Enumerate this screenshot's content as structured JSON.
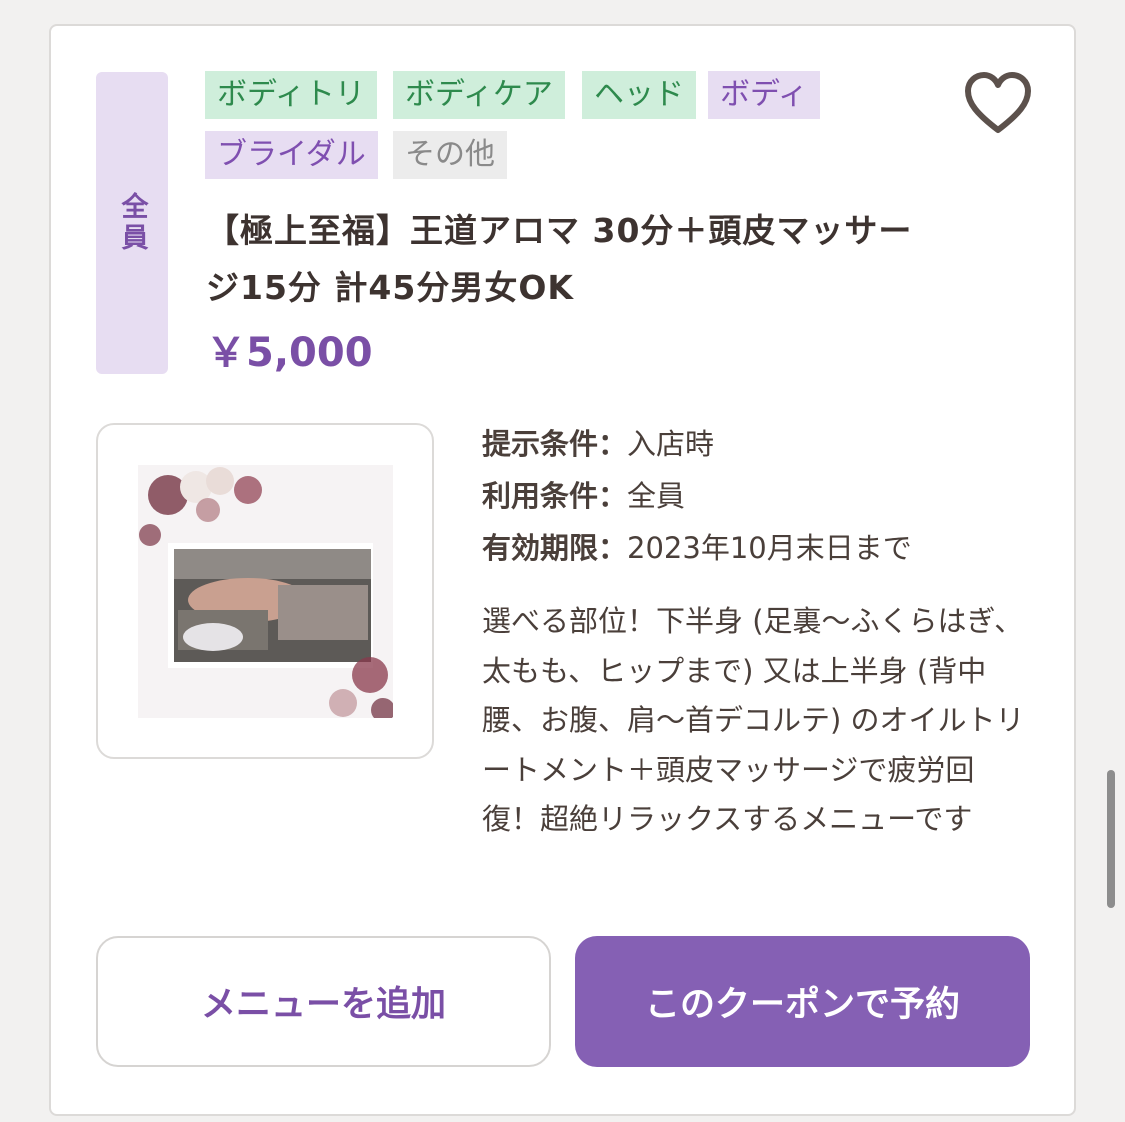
{
  "coupon": {
    "target_label": "全員",
    "tags": [
      {
        "label": "ボディトリ",
        "color": "green"
      },
      {
        "label": "ボディケア",
        "color": "green"
      },
      {
        "label": "ヘッド",
        "color": "green"
      },
      {
        "label": "ボディ",
        "color": "purple"
      },
      {
        "label": "ブライダル",
        "color": "purple"
      },
      {
        "label": "その他",
        "color": "gray"
      }
    ],
    "title": "【極上至福】王道アロマ 30分＋頭皮マッサージ15分 計45分男女OK",
    "price": "￥5,000",
    "conditions": [
      {
        "label": "提示条件：",
        "value": "入店時"
      },
      {
        "label": "利用条件：",
        "value": "全員"
      },
      {
        "label": "有効期限：",
        "value": "2023年10月末日まで"
      }
    ],
    "description": "選べる部位！下半身 (足裏〜ふくらはぎ、太もも、ヒップまで) 又は上半身 (背中腰、お腹、肩〜首デコルテ) のオイルトリートメント＋頭皮マッサージで疲労回復！超絶リラックスするメニューです",
    "buttons": {
      "add_menu": "メニューを追加",
      "book": "このクーポンで予約"
    }
  },
  "icons": {
    "favorite": "heart-outline-icon"
  },
  "colors": {
    "accent": "#7a4fa6",
    "primary_button": "#8560b4",
    "tag_green_bg": "#cfeedb",
    "tag_purple_bg": "#e7ddf2",
    "tag_gray_bg": "#ececec"
  }
}
